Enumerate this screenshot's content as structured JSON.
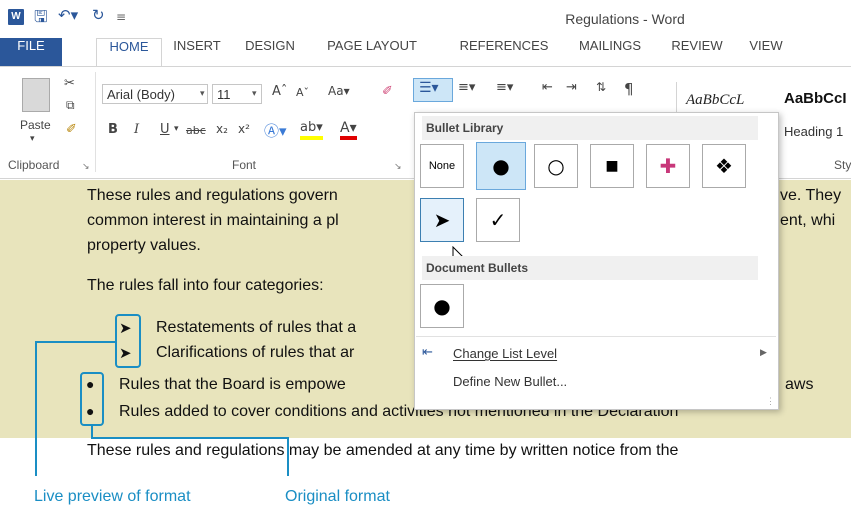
{
  "window": {
    "title": "Regulations - Word"
  },
  "tabs": [
    "FILE",
    "HOME",
    "INSERT",
    "DESIGN",
    "PAGE LAYOUT",
    "REFERENCES",
    "MAILINGS",
    "REVIEW",
    "VIEW"
  ],
  "ribbon": {
    "clipboard": {
      "paste_label": "Paste",
      "group_label": "Clipboard"
    },
    "font": {
      "family": "Arial (Body)",
      "size": "11",
      "group_label": "Font"
    },
    "styles": {
      "sample1": "AaBbCcL",
      "sample2": "AaBbCcI",
      "heading1": "Heading 1",
      "group_label": "Sty"
    }
  },
  "gallery": {
    "library_header": "Bullet Library",
    "none_label": "None",
    "document_header": "Document Bullets",
    "change_list_level": "Change List Level",
    "define_new_bullet": "Define New Bullet..."
  },
  "document": {
    "p1_line1": "These rules and regulations govern",
    "p1_line1_right": "ve. They",
    "p1_line2": "common interest in maintaining a pl",
    "p1_line2_right": "ent, whi",
    "p1_line3": "property values.",
    "p2": "The rules fall into four categories:",
    "bullets": [
      "Restatements of rules that a",
      "Clarifications of rules that ar",
      "Rules that the Board is empowe",
      "Rules added to cover conditions and activities not mentioned in the Declaration"
    ],
    "bullet3_right": "aws",
    "p3": "These rules and regulations may be amended at any time by written notice from the"
  },
  "callouts": {
    "live_preview": "Live preview of format",
    "original": "Original format"
  },
  "colors": {
    "accent": "#2b579a",
    "callout": "#1a8ec4",
    "doc_bg": "#e8e4bc"
  }
}
